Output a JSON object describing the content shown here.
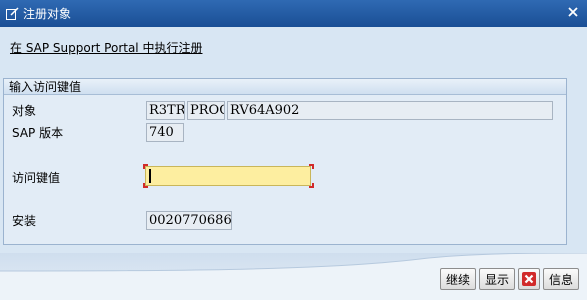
{
  "window": {
    "title": "注册对象",
    "title_icon": "edit-window-icon",
    "close_icon": "close-icon"
  },
  "link": {
    "text": "在 SAP Support Portal 中执行注册"
  },
  "group": {
    "title": "输入访问键值",
    "object_label": "对象",
    "object_values": [
      "R3TR",
      "PROG",
      "RV64A902"
    ],
    "sap_version_label": "SAP 版本",
    "sap_version_value": "740",
    "access_key_label": "访问键值",
    "access_key_value": "",
    "install_label": "安装",
    "install_value": "0020770686"
  },
  "buttons": {
    "continue_label": "继续",
    "display_label": "显示",
    "cancel_icon": "cancel-x-icon",
    "info_label": "信息"
  },
  "colors": {
    "title_bar": "#1f5aa3",
    "input_highlight": "#fdeea0",
    "required_corner": "#d12a2a",
    "cancel_red": "#d12a2a"
  }
}
